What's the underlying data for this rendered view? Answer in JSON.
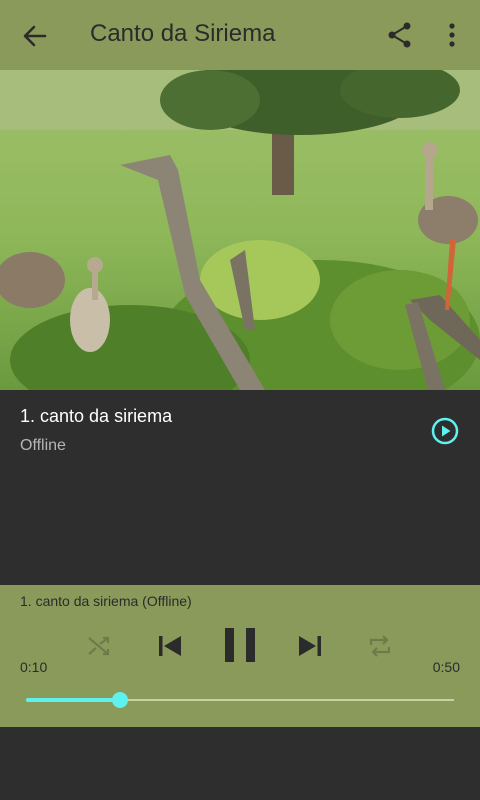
{
  "appbar": {
    "title": "Canto da Siriema",
    "back_icon": "arrow-back-icon",
    "share_icon": "share-icon",
    "more_icon": "more-vert-icon"
  },
  "track": {
    "name": "1. canto da siriema",
    "status": "Offline",
    "play_icon": "play-circle-icon"
  },
  "player": {
    "now_playing": "1. canto da siriema (Offline)",
    "current_time": "0:10",
    "total_time": "0:50",
    "progress_fraction": 0.22,
    "controls": [
      "shuffle-icon",
      "skip-previous-icon",
      "pause-icon",
      "skip-next-icon",
      "repeat-icon"
    ]
  },
  "colors": {
    "accent": "#5ff0f0",
    "bar": "#8a9a5b",
    "background": "#2e2e2e"
  }
}
